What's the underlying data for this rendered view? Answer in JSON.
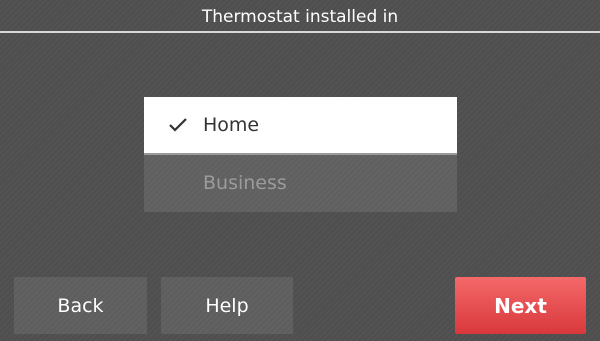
{
  "header": {
    "title": "Thermostat installed in"
  },
  "options": [
    {
      "label": "Home",
      "selected": true
    },
    {
      "label": "Business",
      "selected": false
    }
  ],
  "buttons": {
    "back": "Back",
    "help": "Help",
    "next": "Next"
  },
  "colors": {
    "background": "#4f4f4f",
    "selected_option": "#ffffff",
    "next_button": "#e5484b"
  }
}
